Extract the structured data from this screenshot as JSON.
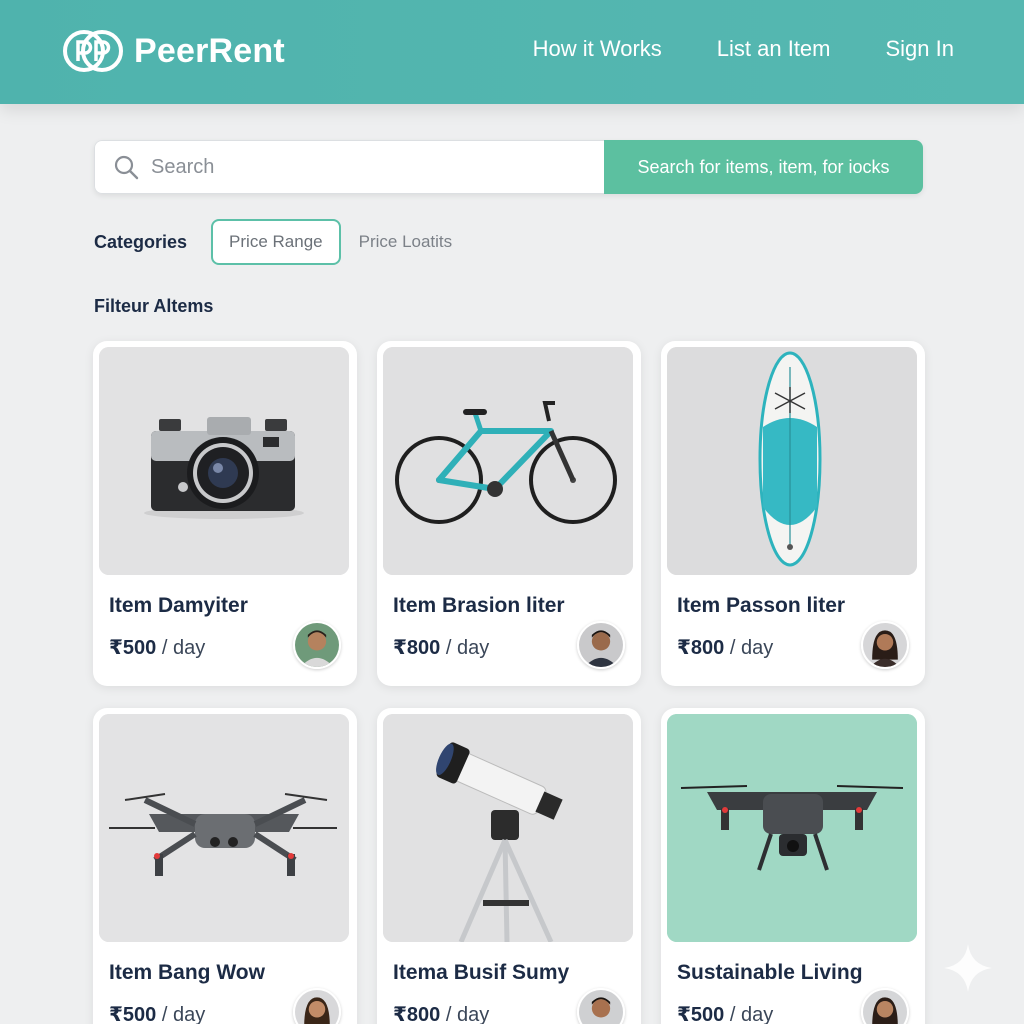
{
  "brand": {
    "name": "PeerRent"
  },
  "nav": {
    "how": "How it Works",
    "list": "List an Item",
    "signin": "Sign In"
  },
  "search": {
    "placeholder": "Search",
    "button": "Search for items, item, for iocks"
  },
  "filters": {
    "label": "Categories",
    "active": "Price Range",
    "other": "Price Loatits"
  },
  "section_title": "Filteur Altems",
  "items": [
    {
      "title": "Item Damyiter",
      "price": "₹500",
      "unit": " / day",
      "icon": "camera-icon"
    },
    {
      "title": "Item Brasion liter",
      "price": "₹800",
      "unit": " / day",
      "icon": "bicycle-icon"
    },
    {
      "title": "Item Passon liter",
      "price": "₹800",
      "unit": " / day",
      "icon": "paddleboard-icon"
    },
    {
      "title": "Item Bang Wow",
      "price": "₹500",
      "unit": " / day",
      "icon": "drone-icon"
    },
    {
      "title": "Itema Busif Sumy",
      "price": "₹800",
      "unit": " / day",
      "icon": "telescope-icon"
    },
    {
      "title": "Sustainable Living",
      "price": "₹500",
      "unit": " / day",
      "icon": "drone-icon"
    }
  ],
  "colors": {
    "header": "#52b5af",
    "accent": "#5cc0a0",
    "text": "#1c2b45"
  }
}
